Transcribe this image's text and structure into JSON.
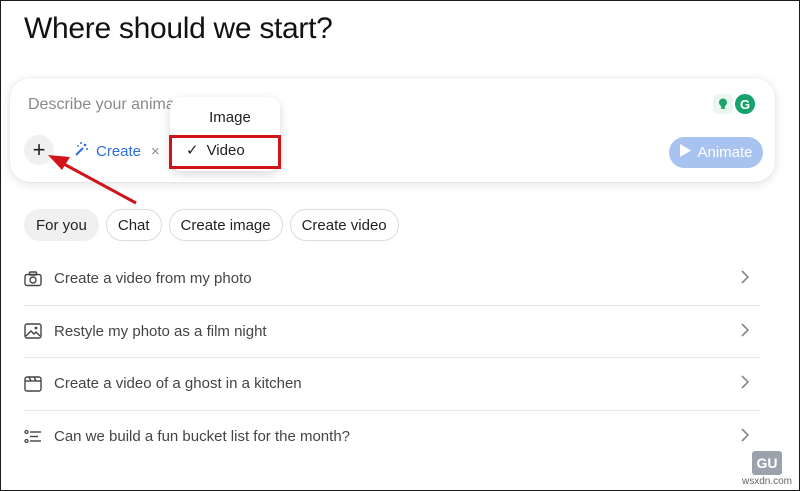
{
  "header": {
    "title": "Where should we start?"
  },
  "composer": {
    "placeholder": "Describe your anima",
    "add_label": "+",
    "create_label": "Create",
    "create_close": "×",
    "animate_label": "Animate",
    "extension_g": "G"
  },
  "menu": {
    "items": [
      {
        "label": "Image",
        "selected": false
      },
      {
        "label": "Video",
        "selected": true,
        "check": "✓"
      }
    ],
    "highlight_color": "#d0141b"
  },
  "tabs": [
    {
      "label": "For you",
      "active": true
    },
    {
      "label": "Chat",
      "active": false
    },
    {
      "label": "Create image",
      "active": false
    },
    {
      "label": "Create video",
      "active": false
    }
  ],
  "suggestions": [
    {
      "icon": "camera-icon",
      "label": "Create a video from my photo"
    },
    {
      "icon": "image-icon",
      "label": "Restyle my photo as a film night"
    },
    {
      "icon": "clapperboard-icon",
      "label": "Create a video of a ghost in a kitchen"
    },
    {
      "icon": "list-icon",
      "label": "Can we build a fun bucket list for the month?"
    }
  ],
  "watermark": {
    "logo": "GU",
    "text": "wsxdn.com"
  },
  "colors": {
    "accent": "#2f6fd6",
    "animate_button": "#a8c3ef",
    "annotation_red": "#d0141b"
  }
}
